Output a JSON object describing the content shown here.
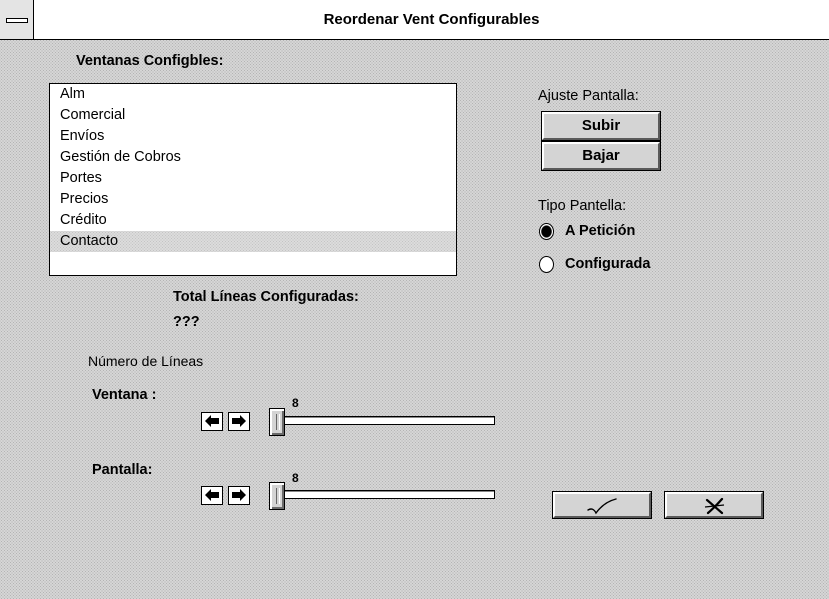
{
  "window": {
    "title": "Reordenar Vent Configurables"
  },
  "ventanas": {
    "label": "Ventanas Configbles:",
    "items": [
      "Alm",
      "Comercial",
      "Envíos",
      "Gestión de Cobros",
      "Portes",
      "Precios",
      "Crédito",
      "Contacto"
    ],
    "selected_index": 7
  },
  "ajuste": {
    "label": "Ajuste Pantalla:",
    "up_label": "Subir",
    "down_label": "Bajar"
  },
  "tipo": {
    "label": "Tipo Pantella:",
    "options": [
      "A Petición",
      "Configurada"
    ],
    "selected_index": 0
  },
  "total": {
    "label": "Total Líneas Configuradas:",
    "value": "???"
  },
  "lineas": {
    "group_label": "Número de Líneas",
    "ventana": {
      "label": "Ventana :",
      "value": "8"
    },
    "pantalla": {
      "label": "Pantalla:",
      "value": "8"
    }
  },
  "actions": {
    "ok_icon": "checkmark-icon",
    "cancel_icon": "x-mark-icon"
  }
}
